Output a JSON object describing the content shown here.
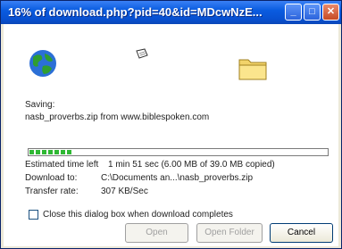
{
  "window": {
    "title": "16% of download.php?pid=40&id=MDcwNzE..."
  },
  "titlebar_buttons": {
    "minimize": "_",
    "maximize": "□",
    "close": "✕"
  },
  "status": {
    "saving_label": "Saving:",
    "saving_text": "nasb_proverbs.zip from www.biblespoken.com",
    "progress_fraction": 0.16,
    "estimated_label": "Estimated time left",
    "estimated_value": "1 min 51 sec (6.00 MB of 39.0 MB copied)",
    "download_to_label": "Download to:",
    "download_to_value": "C:\\Documents an...\\nasb_proverbs.zip",
    "rate_label": "Transfer rate:",
    "rate_value": "307 KB/Sec"
  },
  "checkbox": {
    "label": "Close this dialog box when download completes",
    "checked": false
  },
  "buttons": {
    "open": "Open",
    "open_folder": "Open Folder",
    "cancel": "Cancel"
  },
  "icons": {
    "globe": "globe-icon",
    "paper": "flying-paper-icon",
    "folder": "folder-icon"
  }
}
